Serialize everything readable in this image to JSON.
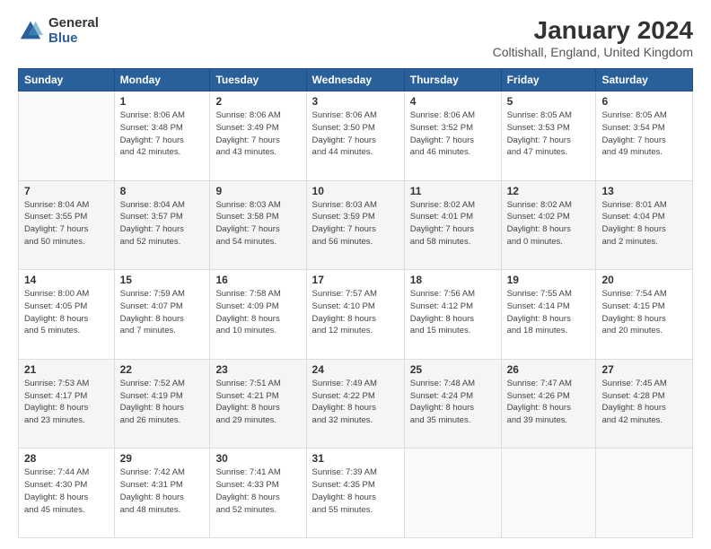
{
  "header": {
    "logo_general": "General",
    "logo_blue": "Blue",
    "main_title": "January 2024",
    "subtitle": "Coltishall, England, United Kingdom"
  },
  "weekdays": [
    "Sunday",
    "Monday",
    "Tuesday",
    "Wednesday",
    "Thursday",
    "Friday",
    "Saturday"
  ],
  "rows": [
    [
      {
        "day": "",
        "info": ""
      },
      {
        "day": "1",
        "info": "Sunrise: 8:06 AM\nSunset: 3:48 PM\nDaylight: 7 hours\nand 42 minutes."
      },
      {
        "day": "2",
        "info": "Sunrise: 8:06 AM\nSunset: 3:49 PM\nDaylight: 7 hours\nand 43 minutes."
      },
      {
        "day": "3",
        "info": "Sunrise: 8:06 AM\nSunset: 3:50 PM\nDaylight: 7 hours\nand 44 minutes."
      },
      {
        "day": "4",
        "info": "Sunrise: 8:06 AM\nSunset: 3:52 PM\nDaylight: 7 hours\nand 46 minutes."
      },
      {
        "day": "5",
        "info": "Sunrise: 8:05 AM\nSunset: 3:53 PM\nDaylight: 7 hours\nand 47 minutes."
      },
      {
        "day": "6",
        "info": "Sunrise: 8:05 AM\nSunset: 3:54 PM\nDaylight: 7 hours\nand 49 minutes."
      }
    ],
    [
      {
        "day": "7",
        "info": "Sunrise: 8:04 AM\nSunset: 3:55 PM\nDaylight: 7 hours\nand 50 minutes."
      },
      {
        "day": "8",
        "info": "Sunrise: 8:04 AM\nSunset: 3:57 PM\nDaylight: 7 hours\nand 52 minutes."
      },
      {
        "day": "9",
        "info": "Sunrise: 8:03 AM\nSunset: 3:58 PM\nDaylight: 7 hours\nand 54 minutes."
      },
      {
        "day": "10",
        "info": "Sunrise: 8:03 AM\nSunset: 3:59 PM\nDaylight: 7 hours\nand 56 minutes."
      },
      {
        "day": "11",
        "info": "Sunrise: 8:02 AM\nSunset: 4:01 PM\nDaylight: 7 hours\nand 58 minutes."
      },
      {
        "day": "12",
        "info": "Sunrise: 8:02 AM\nSunset: 4:02 PM\nDaylight: 8 hours\nand 0 minutes."
      },
      {
        "day": "13",
        "info": "Sunrise: 8:01 AM\nSunset: 4:04 PM\nDaylight: 8 hours\nand 2 minutes."
      }
    ],
    [
      {
        "day": "14",
        "info": "Sunrise: 8:00 AM\nSunset: 4:05 PM\nDaylight: 8 hours\nand 5 minutes."
      },
      {
        "day": "15",
        "info": "Sunrise: 7:59 AM\nSunset: 4:07 PM\nDaylight: 8 hours\nand 7 minutes."
      },
      {
        "day": "16",
        "info": "Sunrise: 7:58 AM\nSunset: 4:09 PM\nDaylight: 8 hours\nand 10 minutes."
      },
      {
        "day": "17",
        "info": "Sunrise: 7:57 AM\nSunset: 4:10 PM\nDaylight: 8 hours\nand 12 minutes."
      },
      {
        "day": "18",
        "info": "Sunrise: 7:56 AM\nSunset: 4:12 PM\nDaylight: 8 hours\nand 15 minutes."
      },
      {
        "day": "19",
        "info": "Sunrise: 7:55 AM\nSunset: 4:14 PM\nDaylight: 8 hours\nand 18 minutes."
      },
      {
        "day": "20",
        "info": "Sunrise: 7:54 AM\nSunset: 4:15 PM\nDaylight: 8 hours\nand 20 minutes."
      }
    ],
    [
      {
        "day": "21",
        "info": "Sunrise: 7:53 AM\nSunset: 4:17 PM\nDaylight: 8 hours\nand 23 minutes."
      },
      {
        "day": "22",
        "info": "Sunrise: 7:52 AM\nSunset: 4:19 PM\nDaylight: 8 hours\nand 26 minutes."
      },
      {
        "day": "23",
        "info": "Sunrise: 7:51 AM\nSunset: 4:21 PM\nDaylight: 8 hours\nand 29 minutes."
      },
      {
        "day": "24",
        "info": "Sunrise: 7:49 AM\nSunset: 4:22 PM\nDaylight: 8 hours\nand 32 minutes."
      },
      {
        "day": "25",
        "info": "Sunrise: 7:48 AM\nSunset: 4:24 PM\nDaylight: 8 hours\nand 35 minutes."
      },
      {
        "day": "26",
        "info": "Sunrise: 7:47 AM\nSunset: 4:26 PM\nDaylight: 8 hours\nand 39 minutes."
      },
      {
        "day": "27",
        "info": "Sunrise: 7:45 AM\nSunset: 4:28 PM\nDaylight: 8 hours\nand 42 minutes."
      }
    ],
    [
      {
        "day": "28",
        "info": "Sunrise: 7:44 AM\nSunset: 4:30 PM\nDaylight: 8 hours\nand 45 minutes."
      },
      {
        "day": "29",
        "info": "Sunrise: 7:42 AM\nSunset: 4:31 PM\nDaylight: 8 hours\nand 48 minutes."
      },
      {
        "day": "30",
        "info": "Sunrise: 7:41 AM\nSunset: 4:33 PM\nDaylight: 8 hours\nand 52 minutes."
      },
      {
        "day": "31",
        "info": "Sunrise: 7:39 AM\nSunset: 4:35 PM\nDaylight: 8 hours\nand 55 minutes."
      },
      {
        "day": "",
        "info": ""
      },
      {
        "day": "",
        "info": ""
      },
      {
        "day": "",
        "info": ""
      }
    ]
  ]
}
